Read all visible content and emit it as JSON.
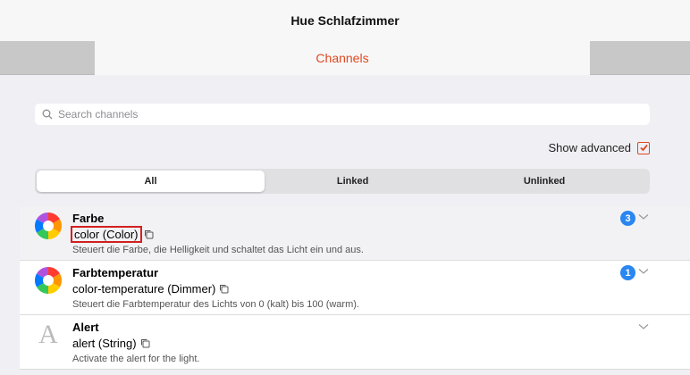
{
  "window": {
    "title": "Hue Schlafzimmer"
  },
  "tabs": {
    "active": "Channels"
  },
  "search": {
    "placeholder": "Search channels"
  },
  "advanced": {
    "label": "Show advanced",
    "checked": true
  },
  "segments": [
    "All",
    "Linked",
    "Unlinked"
  ],
  "channels": [
    {
      "title": "Farbe",
      "id": "color (Color)",
      "desc": "Steuert die Farbe, die Helligkeit und schaltet das Licht ein und aus.",
      "badge": "3",
      "icon": "color-wheel-icon"
    },
    {
      "title": "Farbtemperatur",
      "id": "color-temperature (Dimmer)",
      "desc": "Steuert die Farbtemperatur des Lichts von 0 (kalt) bis 100 (warm).",
      "badge": "1",
      "icon": "color-wheel-icon"
    },
    {
      "title": "Alert",
      "id": "alert (String)",
      "desc": "Activate the alert for the light.",
      "icon": "letter-a-icon",
      "letter": "A"
    }
  ],
  "colors": {
    "accent": "#e0481f",
    "badge": "#2a86f0",
    "highlight_box": "#d32020"
  }
}
